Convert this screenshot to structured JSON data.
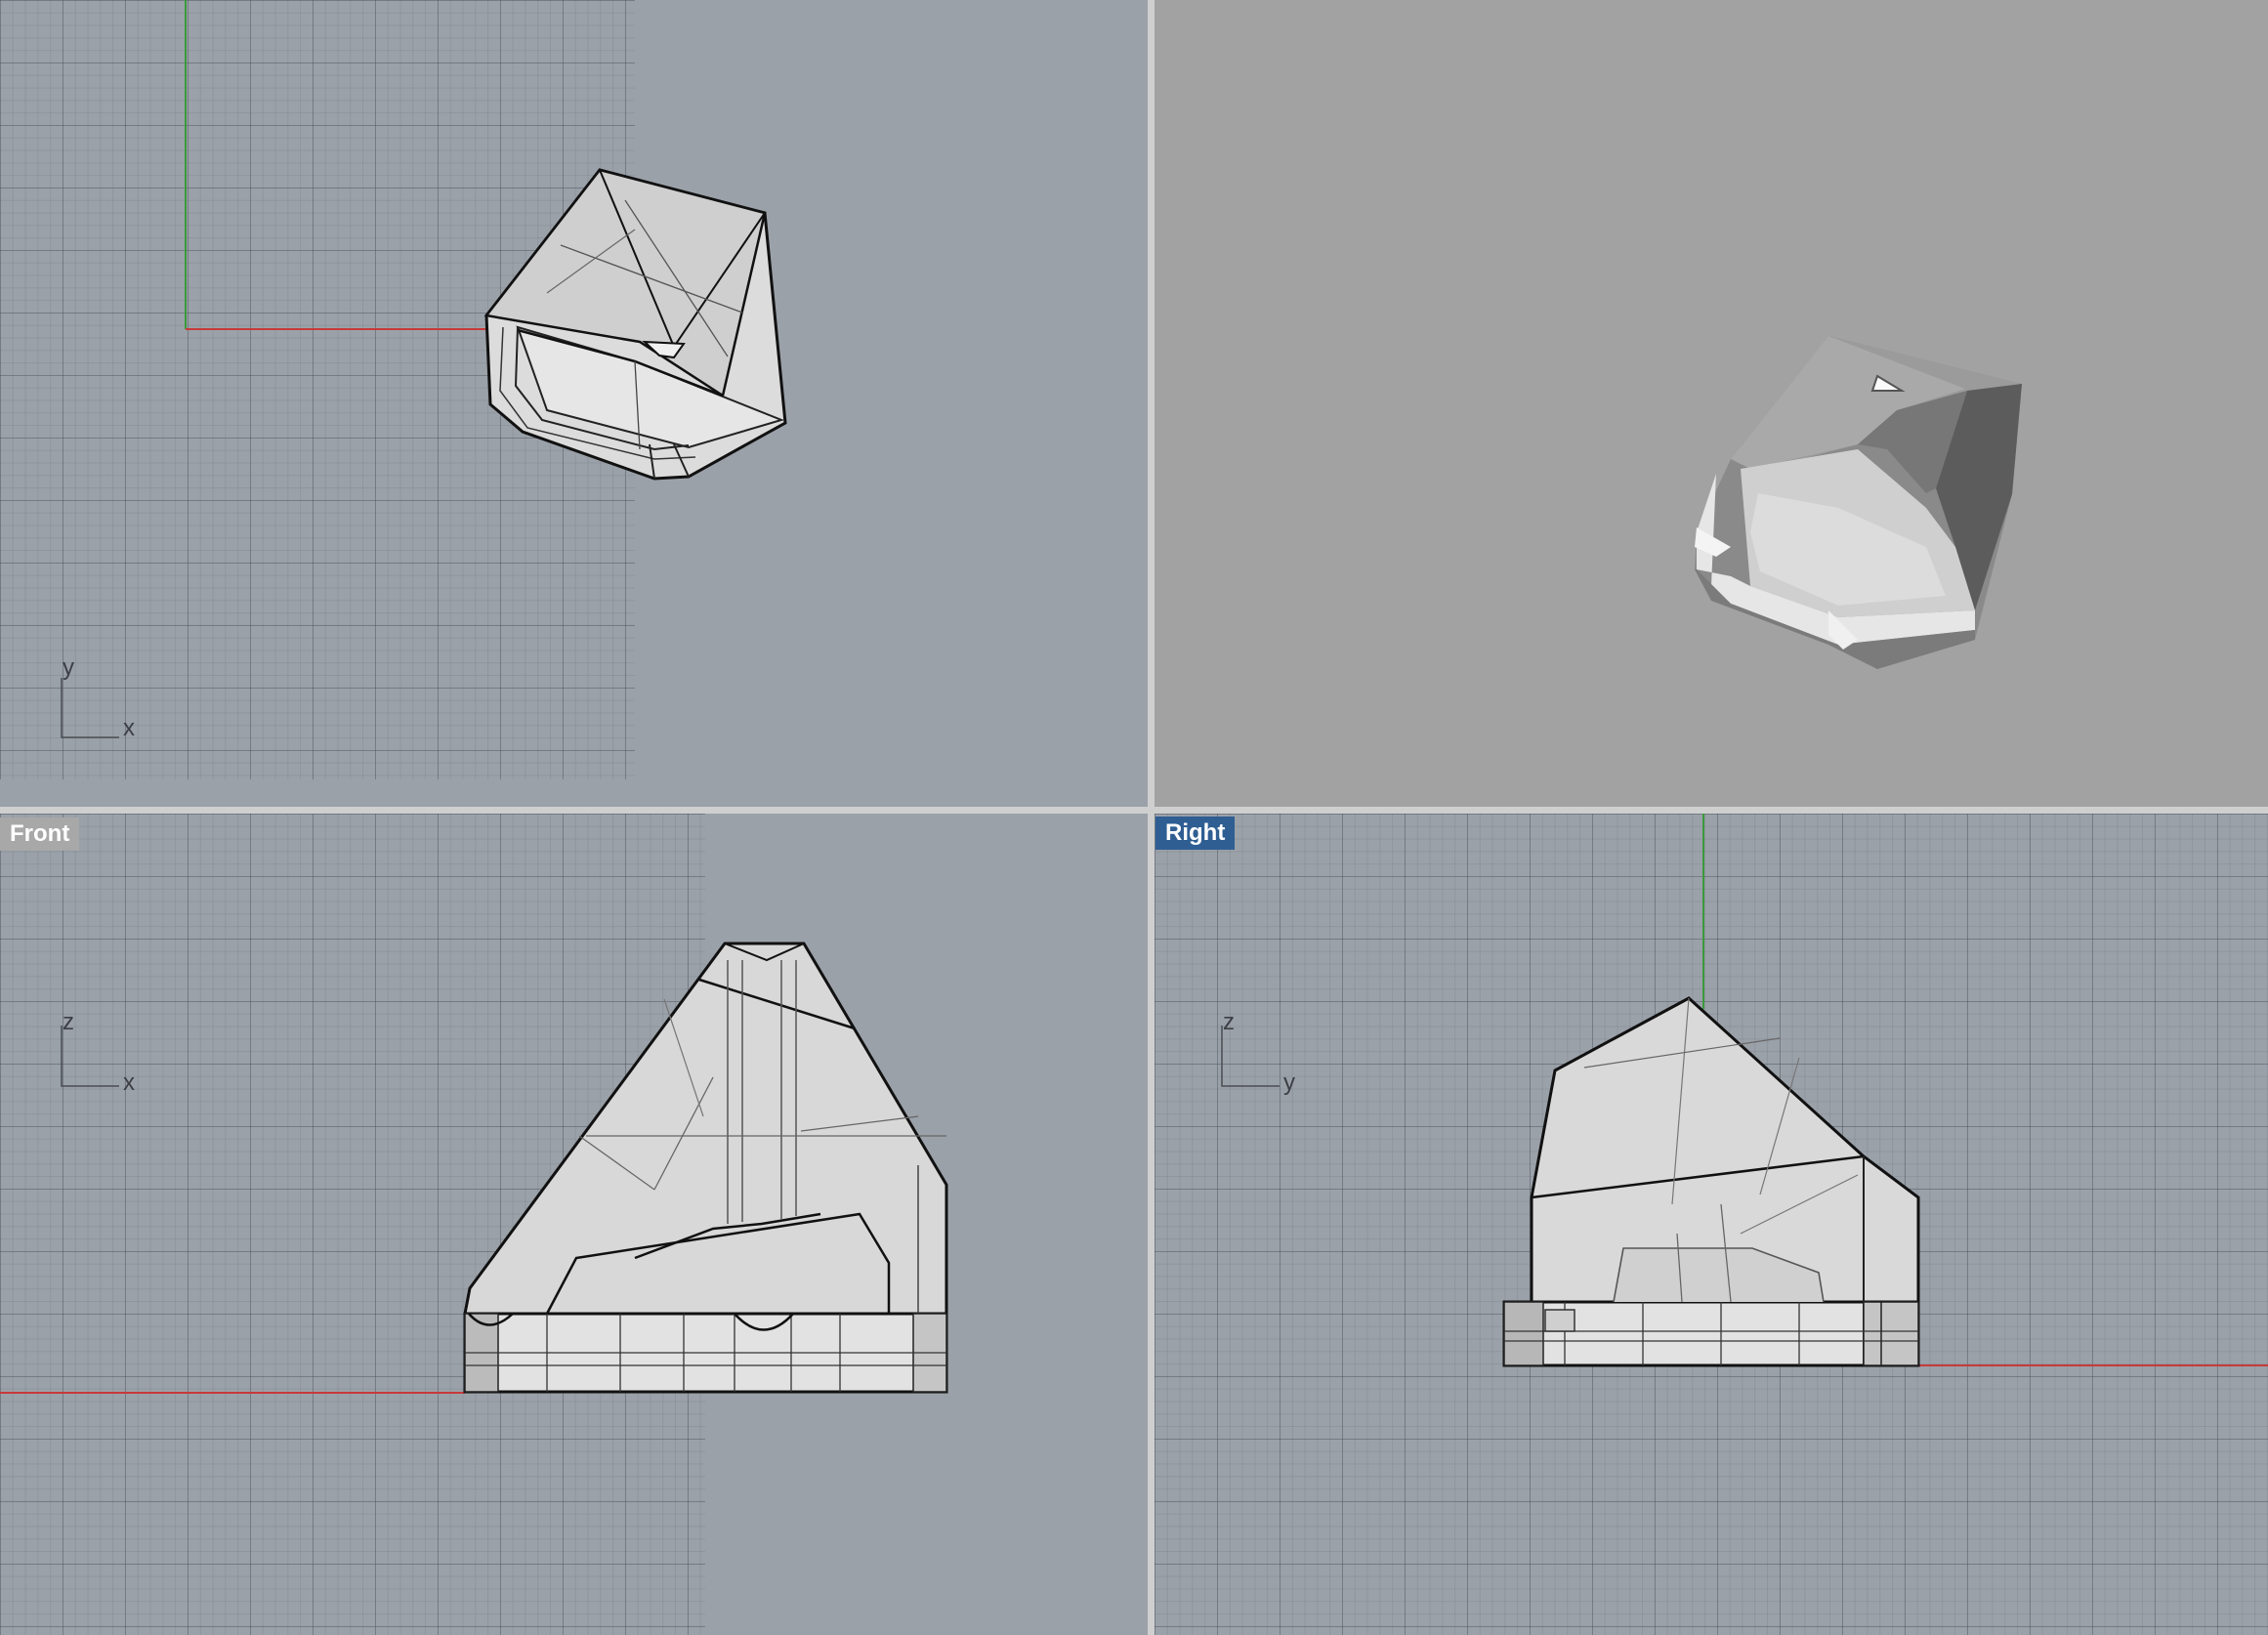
{
  "viewports": {
    "top": {
      "label": "",
      "axis_h": "x",
      "axis_v": "y"
    },
    "perspective": {
      "label": ""
    },
    "front": {
      "label": "Front",
      "axis_h": "x",
      "axis_v": "z"
    },
    "right": {
      "label": "Right",
      "axis_h": "y",
      "axis_v": "z"
    }
  },
  "colors": {
    "viewport_bg": "#9ba1a9",
    "perspective_bg": "#a2a2a2",
    "x_axis": "#c83a3a",
    "y_axis": "#3a9a3a",
    "active_label": "#2f5e92",
    "inactive_label": "#a8a8a8"
  }
}
